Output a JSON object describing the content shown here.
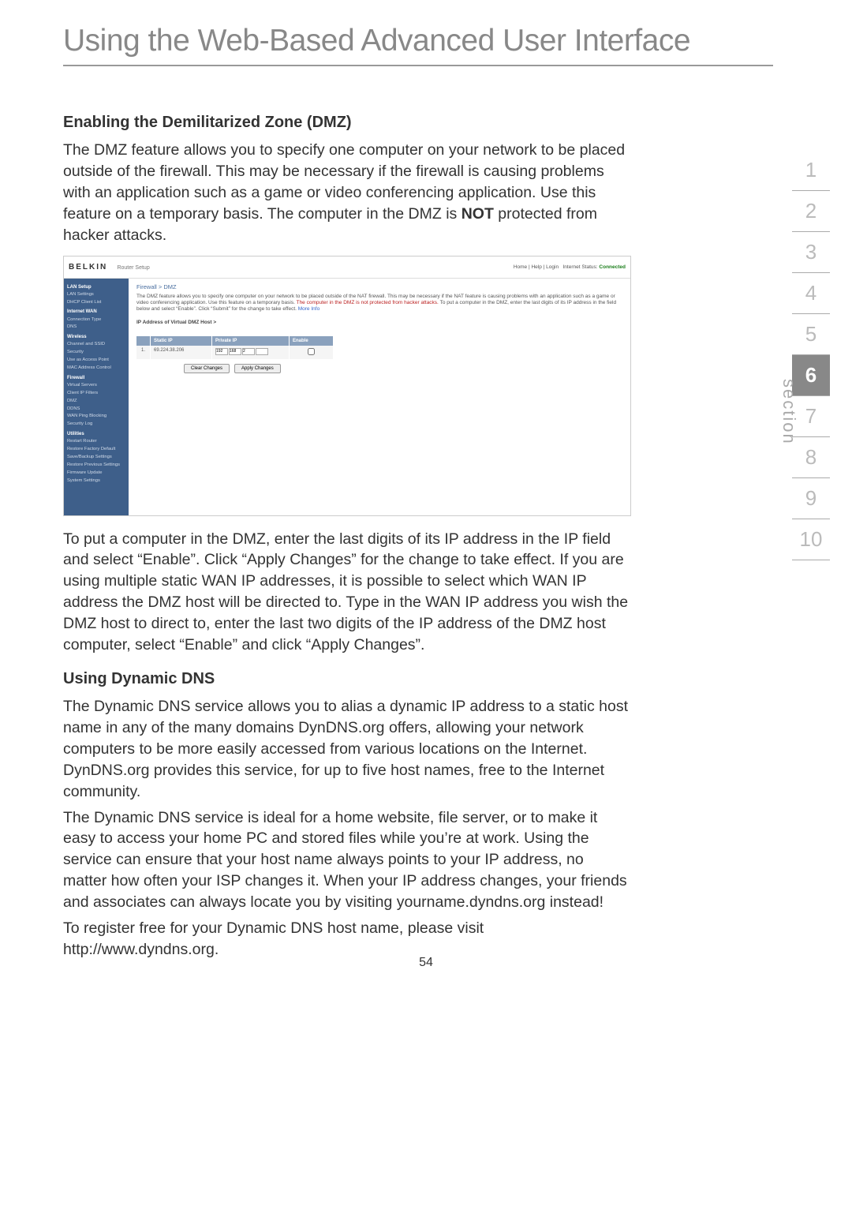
{
  "page": {
    "title": "Using the Web-Based Advanced User Interface",
    "number": "54"
  },
  "section_nav": {
    "label": "section",
    "items": [
      "1",
      "2",
      "3",
      "4",
      "5",
      "6",
      "7",
      "8",
      "9",
      "10"
    ],
    "active_index": 5
  },
  "sec1": {
    "heading": "Enabling the Demilitarized Zone (DMZ)",
    "p1_a": "The DMZ feature allows you to specify one computer on your network to be placed outside of the firewall. This may be necessary if the firewall is causing problems with an application such as a game or video conferencing application. Use this feature on a temporary basis. The computer in the DMZ is ",
    "p1_bold": "NOT",
    "p1_b": " protected from hacker attacks.",
    "p2": "To put a computer in the DMZ, enter the last digits of its IP address in the IP field and select “Enable”. Click “Apply Changes” for the change to take effect. If you are using multiple static WAN IP addresses, it is possible to select which WAN IP address the DMZ host will be directed to. Type in the WAN IP address you wish the DMZ host to direct to, enter the last two digits of the IP address of the DMZ host computer, select “Enable” and click “Apply Changes”."
  },
  "sec2": {
    "heading": "Using Dynamic DNS",
    "p1": "The Dynamic DNS service allows you to alias a dynamic IP address to a static host name in any of the many domains DynDNS.org offers, allowing your network computers to be more easily accessed from various locations on the Internet. DynDNS.org provides this service, for up to five host names, free to the Internet community.",
    "p2": "The Dynamic DNS service is ideal for a home website, file server, or to make it easy to access your home PC and stored files while you’re at work. Using the service can ensure that your host name always points to your IP address, no matter how often your ISP changes it. When your IP address changes, your friends and associates can always locate you by visiting yourname.dyndns.org instead!",
    "p3": "To register free for your Dynamic DNS host name, please visit http://www.dyndns.org."
  },
  "screenshot": {
    "brand": "BELKIN",
    "subtitle": "Router Setup",
    "header_links": {
      "a": "Home",
      "b": "Help",
      "c": "Login",
      "d": "Internet Status:",
      "status": "Connected"
    },
    "sidebar": {
      "g1": "LAN Setup",
      "g1_items": [
        "LAN Settings",
        "DHCP Client List"
      ],
      "g2": "Internet WAN",
      "g2_items": [
        "Connection Type",
        "DNS"
      ],
      "g3": "Wireless",
      "g3_items": [
        "Channel and SSID",
        "Security",
        "Use as Access Point",
        "MAC Address Control"
      ],
      "g4": "Firewall",
      "g4_items": [
        "Virtual Servers",
        "Client IP Filters",
        "DMZ",
        "DDNS",
        "WAN Ping Blocking",
        "Security Log"
      ],
      "g5": "Utilities",
      "g5_items": [
        "Restart Router",
        "Restore Factory Default",
        "Save/Backup Settings",
        "Restore Previous Settings",
        "Firmware Update",
        "System Settings"
      ]
    },
    "main": {
      "breadcrumb": "Firewall > DMZ",
      "desc_a": "The DMZ feature allows you to specify one computer on your network to be placed outside of the NAT firewall. This may be necessary if the NAT feature is causing problems with an application such as a game or video conferencing application. Use this feature on a temporary basis. ",
      "desc_red": "The computer in the DMZ is not protected from hacker attacks.",
      "desc_b": " To put a computer in the DMZ, enter the last digits of its IP address in the field below and select “Enable”. Click “Submit” for the change to take effect. ",
      "desc_link": "More Info",
      "ip_label": "IP Address of Virtual DMZ Host >",
      "th": {
        "c1": "Static IP",
        "c2": "Private IP",
        "c3": "Enable"
      },
      "row": {
        "idx": "1.",
        "static": "69.224.38.206",
        "oct1": "192",
        "oct2": "168",
        "oct3": "2",
        "oct4": ""
      },
      "btn_clear": "Clear Changes",
      "btn_apply": "Apply Changes"
    }
  }
}
